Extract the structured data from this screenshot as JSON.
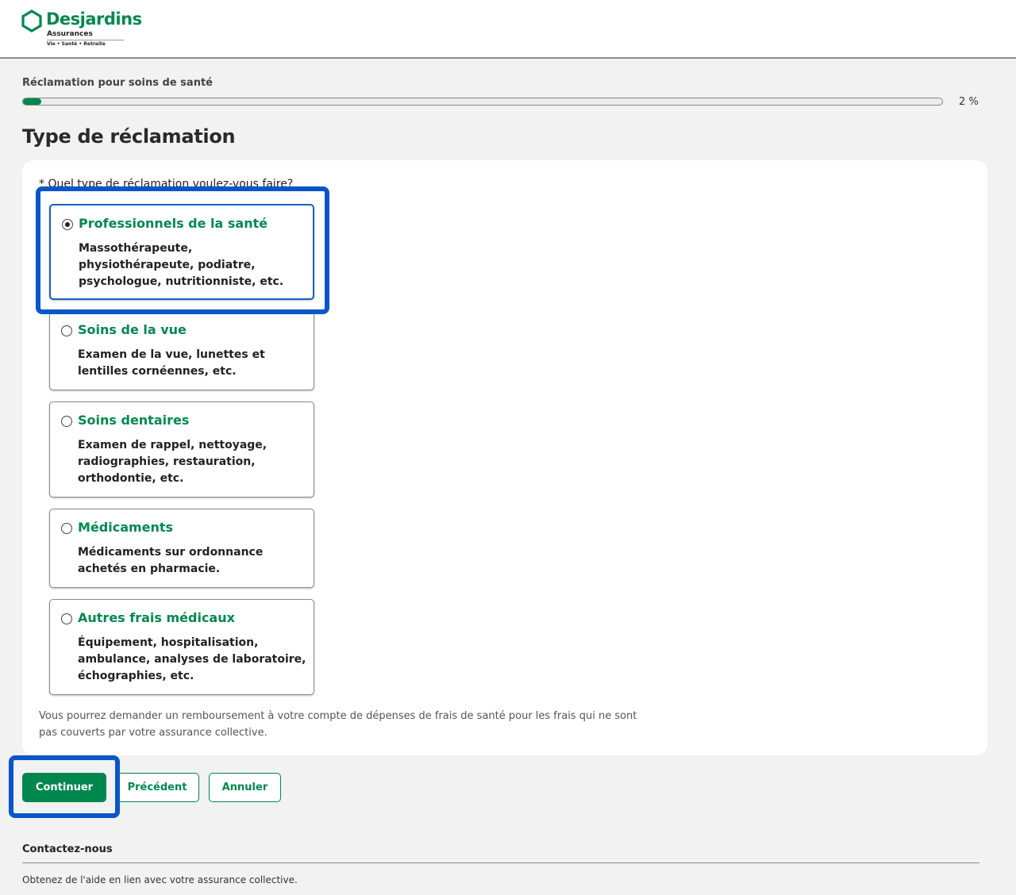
{
  "header": {
    "logo_name": "Desjardins",
    "logo_sub": "Assurances",
    "logo_tagline": "Vie • Santé • Retraite",
    "brand_color": "#00874e"
  },
  "progress": {
    "label": "Réclamation pour soins de santé",
    "percent_text": "2 %",
    "value": 0.02
  },
  "page_title": "Type de réclamation",
  "question": "* Quel type de réclamation voulez-vous faire?",
  "options": [
    {
      "title": "Professionnels de la santé",
      "desc": "Massothérapeute, physiothérapeute, podiatre, psychologue, nutritionniste, etc.",
      "selected": true
    },
    {
      "title": "Soins de la vue",
      "desc": "Examen de la vue, lunettes et lentilles cornéennes, etc.",
      "selected": false
    },
    {
      "title": "Soins dentaires",
      "desc": "Examen de rappel, nettoyage, radiographies, restauration, orthodontie, etc.",
      "selected": false
    },
    {
      "title": "Médicaments",
      "desc": "Médicaments sur ordonnance achetés en pharmacie.",
      "selected": false
    },
    {
      "title": "Autres frais médicaux",
      "desc": "Équipement, hospitalisation, ambulance, analyses de laboratoire, échographies, etc.",
      "selected": false
    }
  ],
  "footnote": "Vous pourrez demander un remboursement à votre compte de dépenses de frais de santé pour les frais qui ne sont pas couverts par votre assurance collective.",
  "buttons": {
    "continue": "Continuer",
    "previous": "Précédent",
    "cancel": "Annuler"
  },
  "footer": {
    "contact_title": "Contactez-nous",
    "contact_text": "Obtenez de l'aide en lien avec votre assurance collective."
  }
}
